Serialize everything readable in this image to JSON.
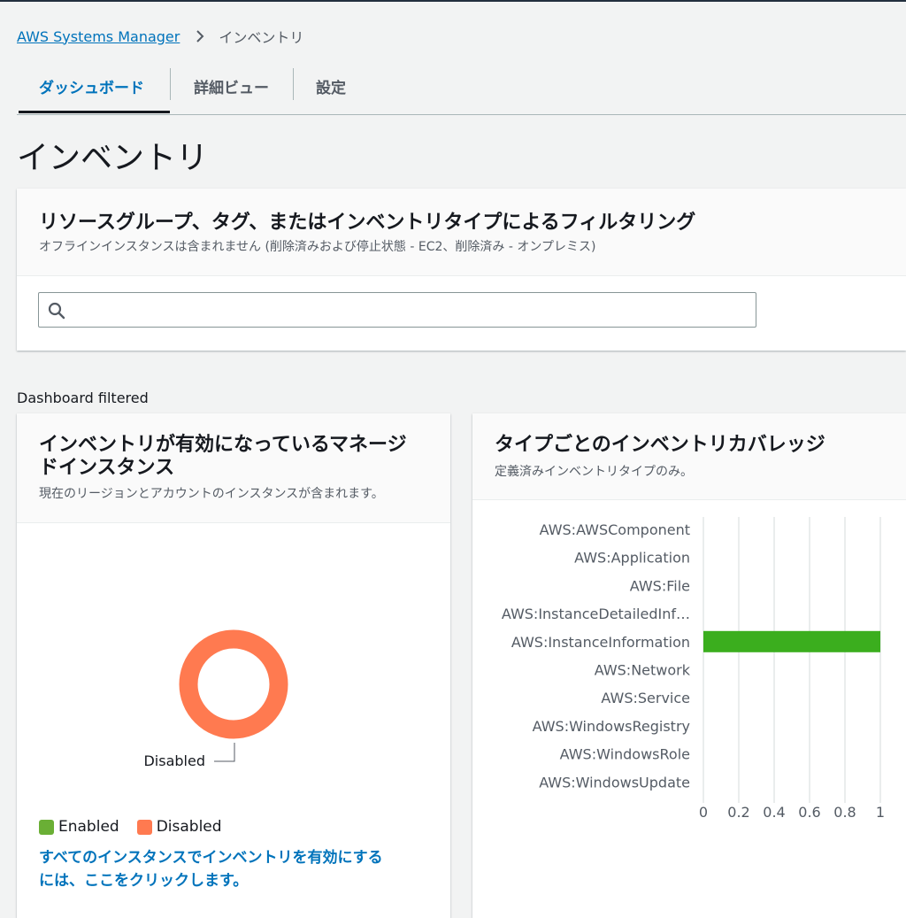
{
  "breadcrumb": {
    "root": "AWS Systems Manager",
    "current": "インベントリ"
  },
  "tabs": [
    {
      "label": "ダッシュボード",
      "active": true
    },
    {
      "label": "詳細ビュー",
      "active": false
    },
    {
      "label": "設定",
      "active": false
    }
  ],
  "page_title": "インベントリ",
  "filter": {
    "title": "リソースグループ、タグ、またはインベントリタイプによるフィルタリング",
    "subtitle": "オフラインインスタンスは含まれません (削除済みおよび停止状態 - EC2、削除済み - オンプレミス)",
    "search_value": "",
    "search_icon": "search-icon"
  },
  "dashboard_filtered": "Dashboard filtered",
  "managed_card": {
    "title_line1": "インベントリが有効になっているマネージ",
    "title_line2": "ドインスタンス",
    "subtitle": "現在のリージョンとアカウントのインスタンスが含まれます。",
    "donut_label": "Disabled",
    "legend": [
      {
        "label": "Enabled",
        "color": "#6aaf35"
      },
      {
        "label": "Disabled",
        "color": "#ff7a50"
      }
    ],
    "link_line1": "すべてのインスタンスでインベントリを有効にする",
    "link_line2": "には、ここをクリックします。"
  },
  "coverage_card": {
    "title": "タイプごとのインベントリカバレッジ",
    "subtitle": "定義済みインベントリタイプのみ。"
  },
  "chart_data": [
    {
      "type": "pie",
      "categories": [
        "Enabled",
        "Disabled"
      ],
      "values": [
        0,
        1
      ],
      "colors": [
        "#6aaf35",
        "#ff7a50"
      ],
      "annotations": [
        "Disabled"
      ]
    },
    {
      "type": "bar",
      "orientation": "horizontal",
      "categories": [
        "AWS:AWSComponent",
        "AWS:Application",
        "AWS:File",
        "AWS:InstanceDetailedInf…",
        "AWS:InstanceInformation",
        "AWS:Network",
        "AWS:Service",
        "AWS:WindowsRegistry",
        "AWS:WindowsRole",
        "AWS:WindowsUpdate"
      ],
      "values": [
        0,
        0,
        0,
        0,
        1,
        0,
        0,
        0,
        0,
        0
      ],
      "color": "#3bae1e",
      "xlim": [
        0,
        1
      ],
      "xticks": [
        "0",
        "0.2",
        "0.4",
        "0.6",
        "0.8",
        "1"
      ],
      "grid": true
    }
  ]
}
